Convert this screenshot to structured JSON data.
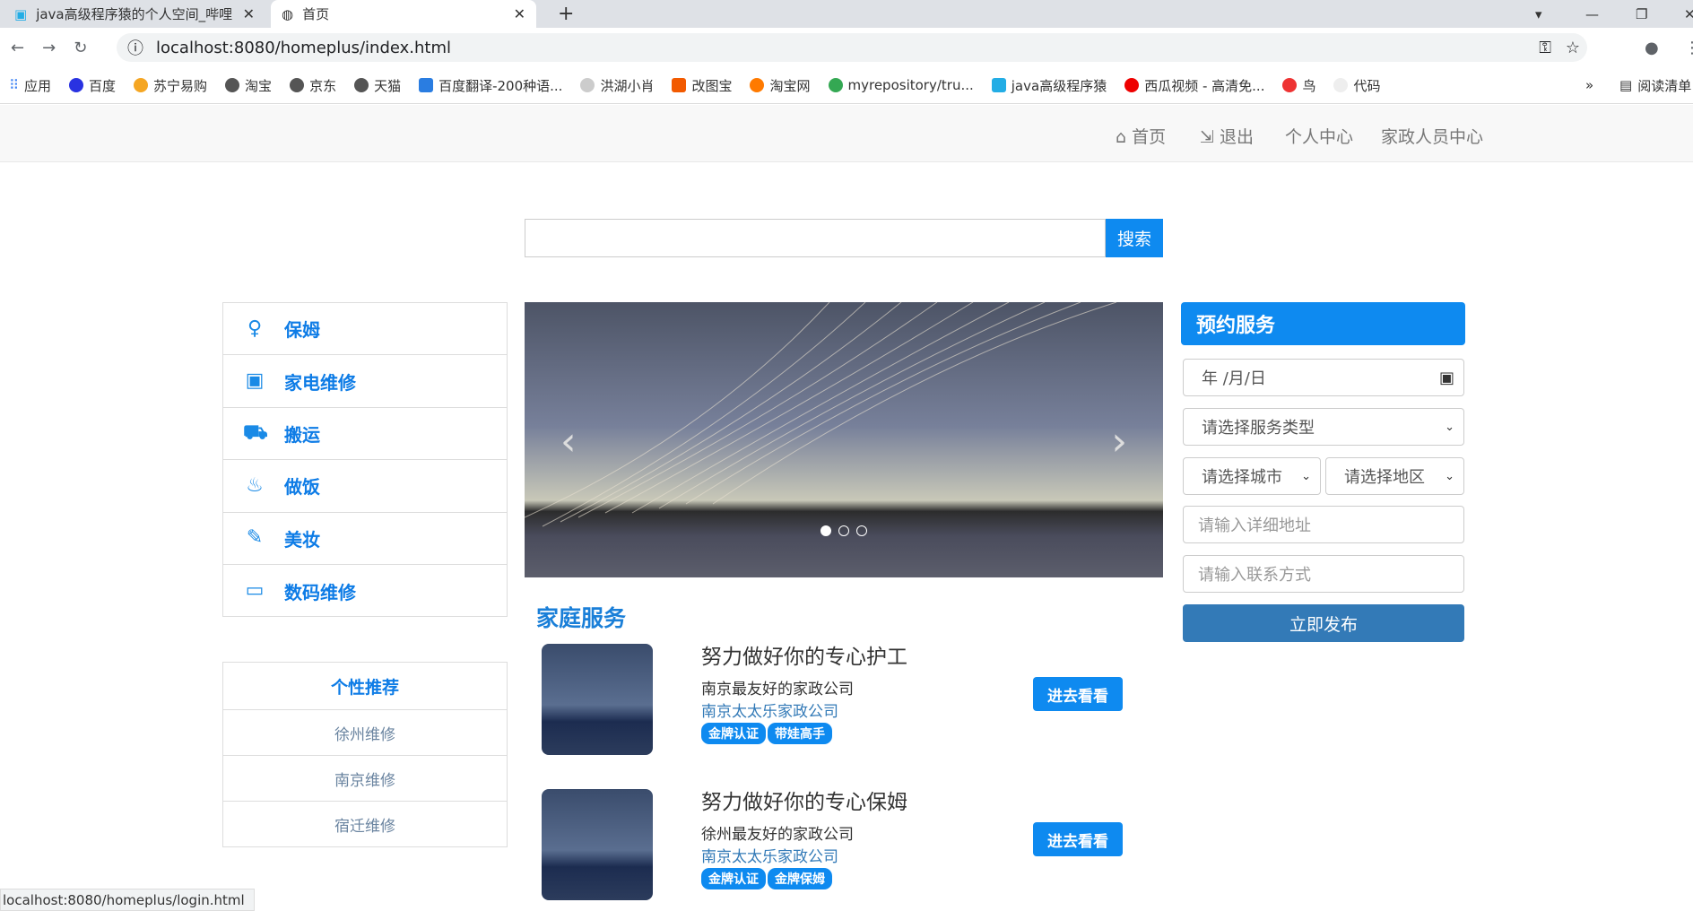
{
  "browser": {
    "tabs": [
      {
        "title": "java高级程序猿的个人空间_哔哩"
      },
      {
        "title": "首页"
      }
    ],
    "url": "localhost:8080/homeplus/index.html",
    "bookmarks": [
      "应用",
      "百度",
      "苏宁易购",
      "淘宝",
      "京东",
      "天猫",
      "百度翻译-200种语...",
      "洪湖小肖",
      "改图宝",
      "淘宝网",
      "myrepository/tru...",
      "java高级程序猿",
      "西瓜视频 - 高清免...",
      "鸟",
      "代码"
    ],
    "reading_list": "阅读清单",
    "status_url": "localhost:8080/homeplus/login.html"
  },
  "nav": {
    "home": "首页",
    "logout": "退出",
    "personal": "个人中心",
    "staff": "家政人员中心"
  },
  "search": {
    "value": "",
    "button": "搜索"
  },
  "categories": [
    {
      "label": "保姆",
      "icon": "nanny-icon"
    },
    {
      "label": "家电维修",
      "icon": "appliance-icon"
    },
    {
      "label": "搬运",
      "icon": "truck-icon"
    },
    {
      "label": "做饭",
      "icon": "cooking-icon"
    },
    {
      "label": "美妆",
      "icon": "makeup-icon"
    },
    {
      "label": "数码维修",
      "icon": "laptop-icon"
    }
  ],
  "carousel": {
    "slides": 3,
    "active": 0
  },
  "section_title": "家庭服务",
  "services": [
    {
      "title": "努力做好你的专心护工",
      "subtitle": "南京最友好的家政公司",
      "company": "南京太太乐家政公司",
      "badges": [
        "金牌认证",
        "带娃高手"
      ],
      "button": "进去看看"
    },
    {
      "title": "努力做好你的专心保姆",
      "subtitle": "徐州最友好的家政公司",
      "company": "南京太太乐家政公司",
      "badges": [
        "金牌认证",
        "金牌保姆"
      ],
      "button": "进去看看"
    }
  ],
  "recommend": {
    "title": "个性推荐",
    "items": [
      "徐州维修",
      "南京维修",
      "宿迁维修"
    ]
  },
  "booking": {
    "title": "预约服务",
    "date_placeholder": "年 /月/日",
    "service_type": "请选择服务类型",
    "city": "请选择城市",
    "district": "请选择地区",
    "address_placeholder": "请输入详细地址",
    "contact_placeholder": "请输入联系方式",
    "submit": "立即发布"
  }
}
